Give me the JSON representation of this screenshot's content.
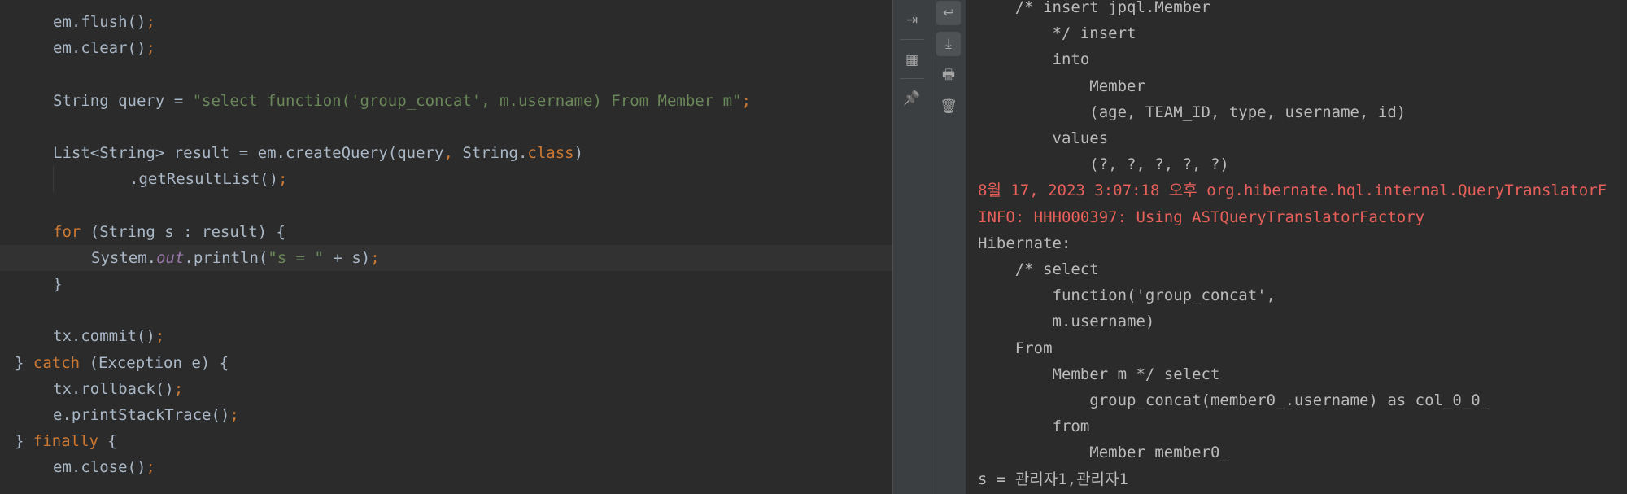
{
  "editor": {
    "lines": [
      {
        "id": "flush",
        "indent": 1,
        "tokens": [
          {
            "t": "em.flush()",
            "c": ""
          },
          {
            "t": ";",
            "c": "pn"
          }
        ]
      },
      {
        "id": "clear",
        "indent": 1,
        "tokens": [
          {
            "t": "em.clear()",
            "c": ""
          },
          {
            "t": ";",
            "c": "pn"
          }
        ]
      },
      {
        "id": "blank1",
        "indent": 0,
        "tokens": []
      },
      {
        "id": "query",
        "indent": 1,
        "tokens": [
          {
            "t": "String query = ",
            "c": ""
          },
          {
            "t": "\"select function('group_concat', m.username) From Member m\"",
            "c": "str"
          },
          {
            "t": ";",
            "c": "pn"
          }
        ]
      },
      {
        "id": "blank2",
        "indent": 0,
        "tokens": []
      },
      {
        "id": "list",
        "indent": 1,
        "tokens": [
          {
            "t": "List<String> result = em.createQuery(query",
            "c": ""
          },
          {
            "t": ",",
            "c": "pn"
          },
          {
            "t": " String.",
            "c": ""
          },
          {
            "t": "class",
            "c": "kw"
          },
          {
            "t": ")",
            "c": ""
          }
        ]
      },
      {
        "id": "getresult",
        "indent": 3,
        "tokens": [
          {
            "t": ".getResultList()",
            "c": ""
          },
          {
            "t": ";",
            "c": "pn"
          }
        ]
      },
      {
        "id": "blank3",
        "indent": 0,
        "tokens": []
      },
      {
        "id": "for",
        "indent": 1,
        "tokens": [
          {
            "t": "for",
            "c": "kw"
          },
          {
            "t": " (String s : result) {",
            "c": ""
          }
        ]
      },
      {
        "id": "println",
        "indent": 2,
        "current": true,
        "tokens": [
          {
            "t": "System.",
            "c": ""
          },
          {
            "t": "out",
            "c": "fld"
          },
          {
            "t": ".println(",
            "c": ""
          },
          {
            "t": "\"s = \"",
            "c": "str"
          },
          {
            "t": " + s)",
            "c": ""
          },
          {
            "t": ";",
            "c": "pn"
          }
        ]
      },
      {
        "id": "close-brace",
        "indent": 1,
        "tokens": [
          {
            "t": "}",
            "c": ""
          }
        ]
      },
      {
        "id": "blank4",
        "indent": 0,
        "tokens": []
      },
      {
        "id": "commit",
        "indent": 1,
        "tokens": [
          {
            "t": "tx.commit()",
            "c": ""
          },
          {
            "t": ";",
            "c": "pn"
          }
        ]
      },
      {
        "id": "catch",
        "indent": 0,
        "tokens": [
          {
            "t": "} ",
            "c": ""
          },
          {
            "t": "catch",
            "c": "kw"
          },
          {
            "t": " (Exception e) {",
            "c": ""
          }
        ]
      },
      {
        "id": "rollback",
        "indent": 1,
        "tokens": [
          {
            "t": "tx.rollback()",
            "c": ""
          },
          {
            "t": ";",
            "c": "pn"
          }
        ]
      },
      {
        "id": "printstack",
        "indent": 1,
        "tokens": [
          {
            "t": "e.printStackTrace()",
            "c": ""
          },
          {
            "t": ";",
            "c": "pn"
          }
        ]
      },
      {
        "id": "finally",
        "indent": 0,
        "tokens": [
          {
            "t": "} ",
            "c": ""
          },
          {
            "t": "finally",
            "c": "kw"
          },
          {
            "t": " {",
            "c": ""
          }
        ]
      },
      {
        "id": "emclose",
        "indent": 1,
        "tokens": [
          {
            "t": "em.close()",
            "c": ""
          },
          {
            "t": ";",
            "c": "pn"
          }
        ]
      }
    ]
  },
  "toolbar": {
    "left": [
      {
        "name": "restore-layout-icon",
        "glyph": "⇥"
      },
      {
        "name": "layout-icon",
        "glyph": "▦"
      },
      {
        "name": "pin-icon",
        "glyph": "📌"
      }
    ],
    "right": [
      {
        "name": "soft-wrap-icon",
        "glyph": "↩",
        "active": true
      },
      {
        "name": "scroll-to-end-icon",
        "glyph": "⤓",
        "active": true
      },
      {
        "name": "print-icon",
        "glyph": "🖶"
      },
      {
        "name": "trash-icon",
        "glyph": "🗑"
      }
    ]
  },
  "console": {
    "lines": [
      {
        "text": "    /* insert jpql.Member",
        "type": "normal"
      },
      {
        "text": "        */ insert",
        "type": "normal"
      },
      {
        "text": "        into",
        "type": "normal"
      },
      {
        "text": "            Member",
        "type": "normal"
      },
      {
        "text": "            (age, TEAM_ID, type, username, id)",
        "type": "normal"
      },
      {
        "text": "        values",
        "type": "normal"
      },
      {
        "text": "            (?, ?, ?, ?, ?)",
        "type": "normal"
      },
      {
        "text": "8월 17, 2023 3:07:18 오후 org.hibernate.hql.internal.QueryTranslatorF",
        "type": "err"
      },
      {
        "text": "INFO: HHH000397: Using ASTQueryTranslatorFactory",
        "type": "err"
      },
      {
        "text": "Hibernate:",
        "type": "normal"
      },
      {
        "text": "    /* select",
        "type": "normal"
      },
      {
        "text": "        function('group_concat',",
        "type": "normal"
      },
      {
        "text": "        m.username)",
        "type": "normal"
      },
      {
        "text": "    From",
        "type": "normal"
      },
      {
        "text": "        Member m */ select",
        "type": "normal"
      },
      {
        "text": "            group_concat(member0_.username) as col_0_0_",
        "type": "normal"
      },
      {
        "text": "        from",
        "type": "normal"
      },
      {
        "text": "            Member member0_",
        "type": "normal"
      },
      {
        "text": "s = 관리자1,관리자1",
        "type": "normal"
      }
    ]
  }
}
